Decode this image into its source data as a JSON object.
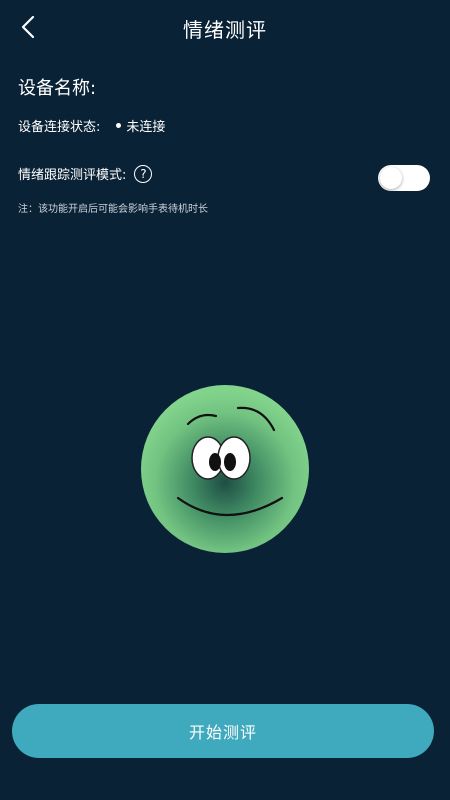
{
  "header": {
    "title": "情绪测评",
    "back_icon": "chevron-left-icon"
  },
  "device": {
    "name_label": "设备名称:",
    "status_label": "设备连接状态:",
    "status_value": "未连接"
  },
  "tracking_mode": {
    "label": "情绪跟踪测评模式:",
    "help_symbol": "?",
    "toggle_on": false,
    "note": "注：该功能开启后可能会影响手表待机时长"
  },
  "emotion_face": {
    "icon": "smiley-face-icon",
    "colors": {
      "outer": "#7fcf89",
      "inner": "#1e4d44"
    }
  },
  "start_button": {
    "label": "开始测评"
  },
  "colors": {
    "background": "#0a2236",
    "accent": "#3fa9bd"
  }
}
